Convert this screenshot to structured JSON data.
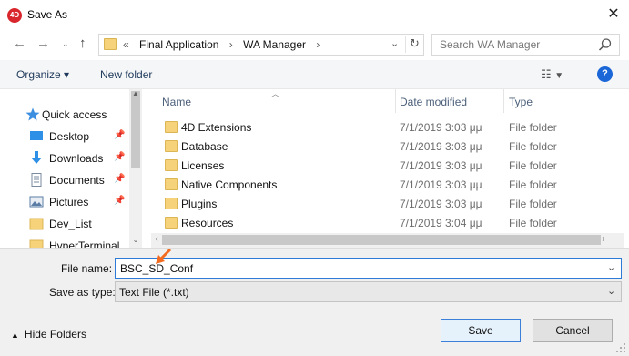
{
  "window": {
    "title": "Save As",
    "app_icon": "4D"
  },
  "address": {
    "crumbs": [
      "«",
      "Final Application",
      "›",
      "WA Manager",
      "›"
    ]
  },
  "search": {
    "placeholder": "Search WA Manager"
  },
  "toolbar": {
    "organize": "Organize ▾",
    "new_folder": "New folder"
  },
  "nav": {
    "items": [
      {
        "label": "Quick access",
        "icon": "star-icon"
      },
      {
        "label": "Desktop",
        "icon": "desktop-icon",
        "pinned": true
      },
      {
        "label": "Downloads",
        "icon": "download-icon",
        "pinned": true
      },
      {
        "label": "Documents",
        "icon": "documents-icon",
        "pinned": true
      },
      {
        "label": "Pictures",
        "icon": "pictures-icon",
        "pinned": true
      },
      {
        "label": "Dev_List",
        "icon": "folder-icon"
      },
      {
        "label": "HyperTerminal",
        "icon": "folder-icon"
      }
    ]
  },
  "columns": {
    "name": "Name",
    "date": "Date modified",
    "type": "Type"
  },
  "files": [
    {
      "name": "4D Extensions",
      "date": "7/1/2019 3:03 μμ",
      "type": "File folder"
    },
    {
      "name": "Database",
      "date": "7/1/2019 3:03 μμ",
      "type": "File folder"
    },
    {
      "name": "Licenses",
      "date": "7/1/2019 3:03 μμ",
      "type": "File folder"
    },
    {
      "name": "Native Components",
      "date": "7/1/2019 3:03 μμ",
      "type": "File folder"
    },
    {
      "name": "Plugins",
      "date": "7/1/2019 3:03 μμ",
      "type": "File folder"
    },
    {
      "name": "Resources",
      "date": "7/1/2019 3:04 μμ",
      "type": "File folder"
    }
  ],
  "form": {
    "file_name_label": "File name:",
    "file_name_value": "BSC_SD_Conf",
    "save_type_label": "Save as type:",
    "save_type_value": "Text File (*.txt)"
  },
  "footer": {
    "hide_folders": "Hide Folders",
    "save": "Save",
    "cancel": "Cancel"
  },
  "colors": {
    "accent": "#2d7bd6",
    "folder": "#f6d37a",
    "cursor": "#f26b21"
  }
}
